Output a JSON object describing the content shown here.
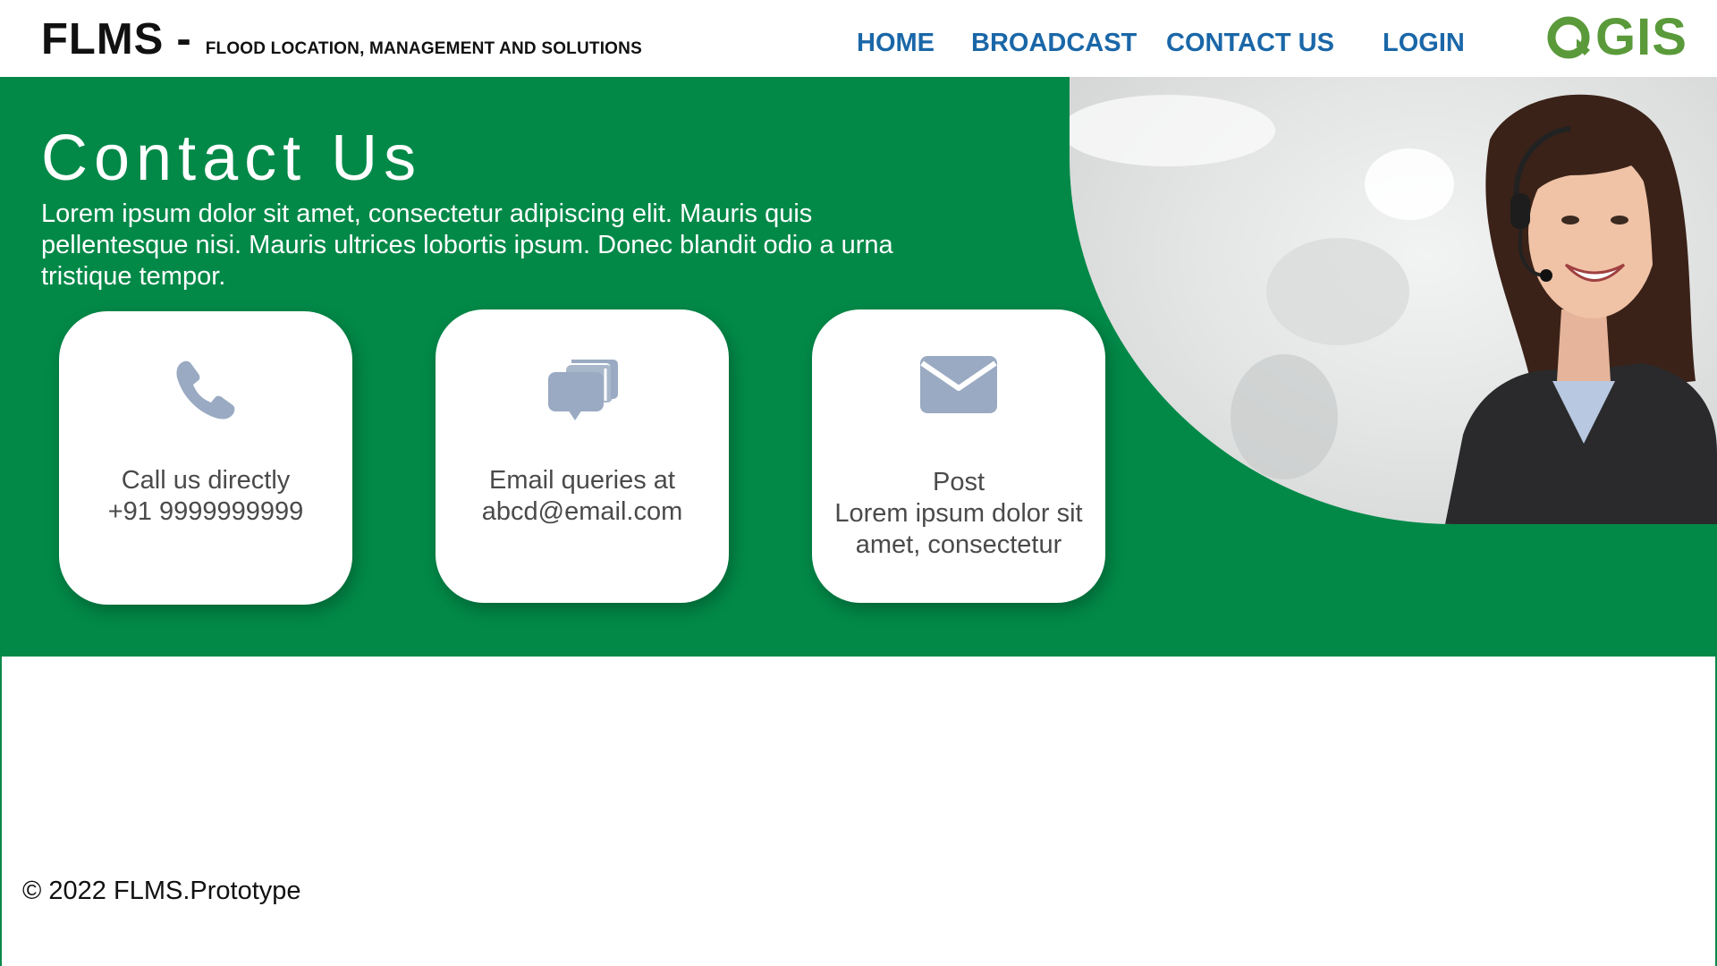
{
  "header": {
    "brand_name": "FLMS",
    "brand_dash": "-",
    "brand_subtitle": "FLOOD LOCATION, MANAGEMENT AND SOLUTIONS",
    "nav": [
      {
        "label": "HOME"
      },
      {
        "label": "BROADCAST"
      },
      {
        "label": "CONTACT US"
      },
      {
        "label": "LOGIN"
      }
    ],
    "logo_text": "GIS",
    "logo_alt": "QGIS"
  },
  "hero": {
    "title": "Contact Us",
    "description": "Lorem ipsum dolor sit amet, consectetur adipiscing elit. Mauris quis pellentesque nisi. Mauris ultrices lobortis ipsum. Donec blandit odio a urna tristique tempor."
  },
  "cards": [
    {
      "icon": "phone-icon",
      "line1": "Call us directly",
      "line2": "+91 9999999999"
    },
    {
      "icon": "chat-bubbles-icon",
      "line1": "Email queries at",
      "line2": "abcd@email.com"
    },
    {
      "icon": "envelope-icon",
      "line1": "Post",
      "line2": "Lorem ipsum dolor sit",
      "line3": "amet, consectetur"
    }
  ],
  "footer": {
    "copyright": "© 2022 FLMS.Prototype"
  },
  "colors": {
    "brand_green": "#028948",
    "nav_blue": "#1a67a8",
    "icon_slate": "#9aaac2",
    "logo_green": "#5a9a3a"
  }
}
